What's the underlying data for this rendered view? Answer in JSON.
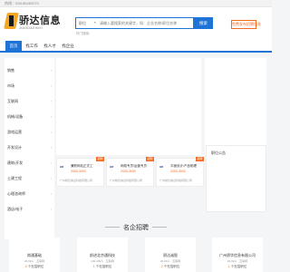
{
  "topbar": {
    "text": "热线：028-86282070"
  },
  "header": {
    "logo_name": "骄达信息",
    "logo_sub": "JIAODAXINXI",
    "search": {
      "category": "职位",
      "placeholder": "请输入要搜索的关键字，如：企业名称/职位名称"
    },
    "search_button": "搜索",
    "publish_button": "免费发布招聘信息",
    "hot_words": "热门搜索："
  },
  "nav": {
    "items": [
      {
        "label": "首页",
        "active": true
      },
      {
        "label": "找工作",
        "active": false
      },
      {
        "label": "找人才",
        "active": false
      },
      {
        "label": "找企业",
        "active": false
      }
    ]
  },
  "sidebar": {
    "items": [
      {
        "label": "销售"
      },
      {
        "label": "市场"
      },
      {
        "label": "互联网"
      },
      {
        "label": "机械/设备"
      },
      {
        "label": "游戏运营"
      },
      {
        "label": "开发设计"
      },
      {
        "label": "建筑/开发"
      },
      {
        "label": "土建工程"
      },
      {
        "label": "心理咨询师"
      },
      {
        "label": "酒店/电子"
      }
    ]
  },
  "right_panel": {
    "title": "职位公告"
  },
  "job_cards": [
    {
      "tag": "招聘",
      "logo": "HR",
      "job": "兼职网站正式工",
      "salary": "2000-3000",
      "company": "广州骄达信息科技有限公司"
    },
    {
      "tag": "招聘",
      "logo": "HR",
      "job": "网络专员/运营专员",
      "salary": "2000-3000",
      "company": "广州骄达信息科技有限公司"
    },
    {
      "tag": "招聘",
      "logo": "HR",
      "job": "平面设计/产品助理",
      "salary": "2000-3000",
      "company": "广州骄达信息科技有限公司"
    }
  ],
  "section": {
    "title": "名企招聘"
  },
  "companies": [
    {
      "name": "岗通基础",
      "meta": "20-99人 · 互联网",
      "jobs_prefix": "3",
      "jobs_suffix": " 个在招职位"
    },
    {
      "name": "前进北京通科技",
      "meta": "100-499人 · 互联网",
      "jobs_prefix": "1",
      "jobs_suffix": " 个在招职位"
    },
    {
      "name": "骄达诚智",
      "meta": "20-99人 · 互联网",
      "jobs_prefix": "2",
      "jobs_suffix": " 个在招职位"
    },
    {
      "name": "广州骄华信息有限公司",
      "meta": "20-99人 · 互联网",
      "jobs_prefix": "1",
      "jobs_suffix": " 个在招职位"
    }
  ],
  "colors": {
    "primary": "#1e73d6",
    "accent": "#f36b21",
    "logo_yellow": "#f5a623"
  }
}
